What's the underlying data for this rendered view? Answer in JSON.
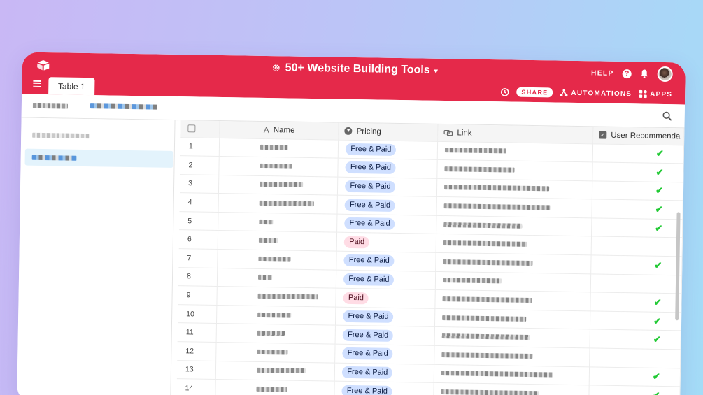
{
  "app": {
    "base_title": "50+ Website Building Tools",
    "help_label": "HELP",
    "help_symbol": "?",
    "active_tab": "Table 1",
    "share_label": "SHARE",
    "automations_label": "AUTOMATIONS",
    "apps_label": "APPS",
    "brand_color": "#e5294a"
  },
  "columns": [
    {
      "label": "Name",
      "icon": "text-field-icon"
    },
    {
      "label": "Pricing",
      "icon": "single-select-icon"
    },
    {
      "label": "Link",
      "icon": "link-icon"
    },
    {
      "label": "User Recommenda",
      "icon": "checkbox-field-icon"
    }
  ],
  "pill_colors": {
    "Free & Paid": {
      "bg": "#cfdfff",
      "fg": "#102046"
    },
    "Paid": {
      "bg": "#ffdce5",
      "fg": "#4c0c1c"
    }
  },
  "rows": [
    {
      "n": "1",
      "pricing": "Free & Paid",
      "check": "✔"
    },
    {
      "n": "2",
      "pricing": "Free & Paid",
      "check": "✔"
    },
    {
      "n": "3",
      "pricing": "Free & Paid",
      "check": "✔"
    },
    {
      "n": "4",
      "pricing": "Free & Paid",
      "check": "✔"
    },
    {
      "n": "5",
      "pricing": "Free & Paid",
      "check": "✔"
    },
    {
      "n": "6",
      "pricing": "Paid",
      "check": ""
    },
    {
      "n": "7",
      "pricing": "Free & Paid",
      "check": "✔"
    },
    {
      "n": "8",
      "pricing": "Free & Paid",
      "check": ""
    },
    {
      "n": "9",
      "pricing": "Paid",
      "check": "✔"
    },
    {
      "n": "10",
      "pricing": "Free & Paid",
      "check": "✔"
    },
    {
      "n": "11",
      "pricing": "Free & Paid",
      "check": "✔"
    },
    {
      "n": "12",
      "pricing": "Free & Paid",
      "check": ""
    },
    {
      "n": "13",
      "pricing": "Free & Paid",
      "check": "✔"
    },
    {
      "n": "14",
      "pricing": "Free & Paid",
      "check": "✔"
    }
  ]
}
